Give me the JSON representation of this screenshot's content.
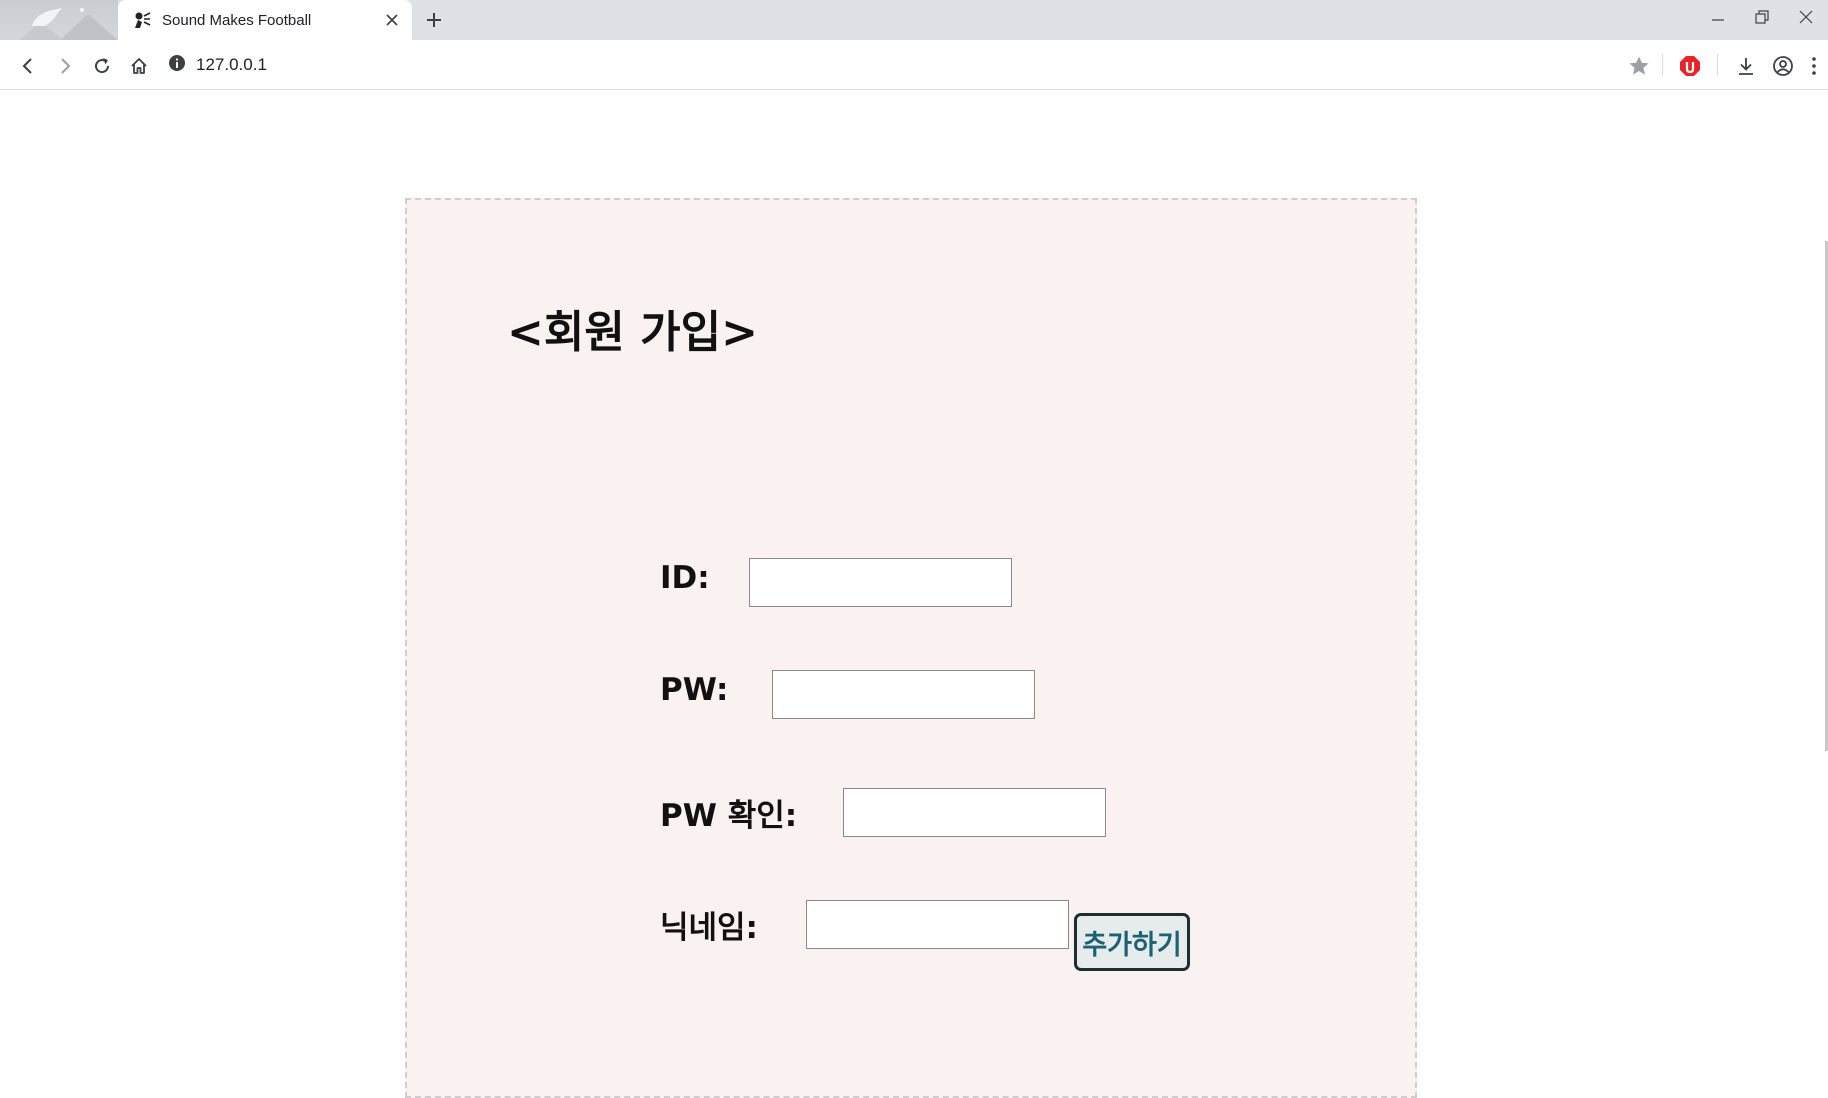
{
  "browser": {
    "tab": {
      "title": "Sound Makes Football"
    },
    "address_bar": {
      "url": "127.0.0.1"
    }
  },
  "page": {
    "title": "<회원 가입>",
    "fields": [
      {
        "label": "ID:",
        "value": "",
        "placeholder": ""
      },
      {
        "label": "PW:",
        "value": "",
        "placeholder": ""
      },
      {
        "label": "PW 확인:",
        "value": "",
        "placeholder": ""
      },
      {
        "label": "닉네임:",
        "value": "",
        "placeholder": ""
      }
    ],
    "submit_label": "추가하기"
  },
  "colors": {
    "form_background": "#faf2f0",
    "form_border": "#d2cccc",
    "button_text": "#1d6174",
    "button_border": "#1e2d33",
    "button_background": "#e6ecec"
  }
}
